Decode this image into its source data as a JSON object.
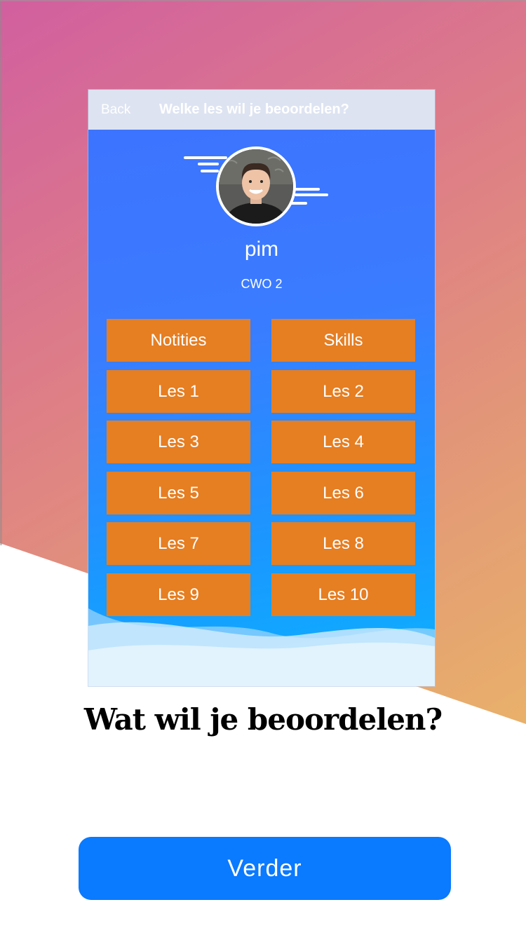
{
  "nav": {
    "back_label": "Back",
    "title": "Welke les wil je beoordelen?"
  },
  "profile": {
    "name": "pim",
    "level": "CWO 2"
  },
  "buttons": [
    {
      "label": "Notities"
    },
    {
      "label": "Skills"
    },
    {
      "label": "Les 1"
    },
    {
      "label": "Les 2"
    },
    {
      "label": "Les 3"
    },
    {
      "label": "Les 4"
    },
    {
      "label": "Les 5"
    },
    {
      "label": "Les 6"
    },
    {
      "label": "Les 7"
    },
    {
      "label": "Les 8"
    },
    {
      "label": "Les 9"
    },
    {
      "label": "Les 10"
    }
  ],
  "headline": "Wat wil je beoordelen?",
  "cta": {
    "label": "Verder"
  },
  "colors": {
    "button_orange": "#e67e22",
    "cta_blue": "#0a7aff",
    "nav_bg": "#dde3f1"
  }
}
